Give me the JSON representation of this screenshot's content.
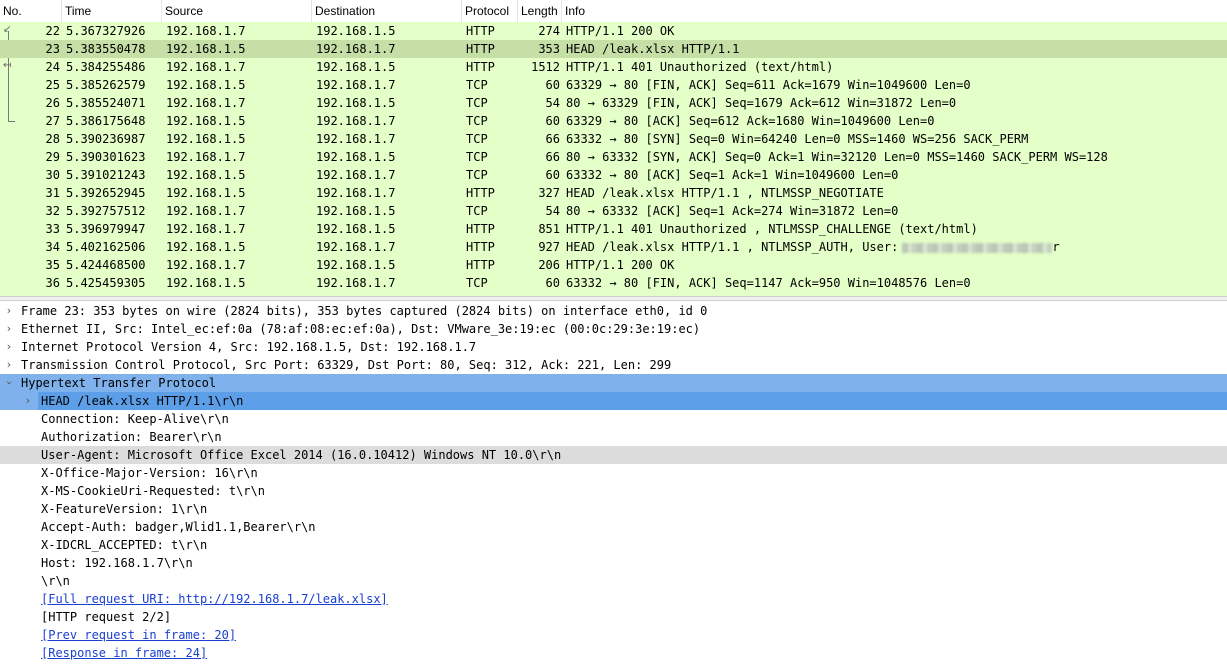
{
  "columns": {
    "no": "No.",
    "time": "Time",
    "source": "Source",
    "destination": "Destination",
    "protocol": "Protocol",
    "length": "Length",
    "info": "Info"
  },
  "packets": [
    {
      "no": "22",
      "time": "5.367327926",
      "src": "192.168.1.7",
      "dst": "192.168.1.5",
      "proto": "HTTP",
      "len": "274",
      "info": "HTTP/1.1 200 OK"
    },
    {
      "no": "23",
      "time": "5.383550478",
      "src": "192.168.1.5",
      "dst": "192.168.1.7",
      "proto": "HTTP",
      "len": "353",
      "info": "HEAD /leak.xlsx HTTP/1.1"
    },
    {
      "no": "24",
      "time": "5.384255486",
      "src": "192.168.1.7",
      "dst": "192.168.1.5",
      "proto": "HTTP",
      "len": "1512",
      "info": "HTTP/1.1 401 Unauthorized  (text/html)"
    },
    {
      "no": "25",
      "time": "5.385262579",
      "src": "192.168.1.5",
      "dst": "192.168.1.7",
      "proto": "TCP",
      "len": "60",
      "info": "63329 → 80 [FIN, ACK] Seq=611 Ack=1679 Win=1049600 Len=0"
    },
    {
      "no": "26",
      "time": "5.385524071",
      "src": "192.168.1.7",
      "dst": "192.168.1.5",
      "proto": "TCP",
      "len": "54",
      "info": "80 → 63329 [FIN, ACK] Seq=1679 Ack=612 Win=31872 Len=0"
    },
    {
      "no": "27",
      "time": "5.386175648",
      "src": "192.168.1.5",
      "dst": "192.168.1.7",
      "proto": "TCP",
      "len": "60",
      "info": "63329 → 80 [ACK] Seq=612 Ack=1680 Win=1049600 Len=0"
    },
    {
      "no": "28",
      "time": "5.390236987",
      "src": "192.168.1.5",
      "dst": "192.168.1.7",
      "proto": "TCP",
      "len": "66",
      "info": "63332 → 80 [SYN] Seq=0 Win=64240 Len=0 MSS=1460 WS=256 SACK_PERM"
    },
    {
      "no": "29",
      "time": "5.390301623",
      "src": "192.168.1.7",
      "dst": "192.168.1.5",
      "proto": "TCP",
      "len": "66",
      "info": "80 → 63332 [SYN, ACK] Seq=0 Ack=1 Win=32120 Len=0 MSS=1460 SACK_PERM WS=128"
    },
    {
      "no": "30",
      "time": "5.391021243",
      "src": "192.168.1.5",
      "dst": "192.168.1.7",
      "proto": "TCP",
      "len": "60",
      "info": "63332 → 80 [ACK] Seq=1 Ack=1 Win=1049600 Len=0"
    },
    {
      "no": "31",
      "time": "5.392652945",
      "src": "192.168.1.5",
      "dst": "192.168.1.7",
      "proto": "HTTP",
      "len": "327",
      "info": "HEAD /leak.xlsx HTTP/1.1 , NTLMSSP_NEGOTIATE"
    },
    {
      "no": "32",
      "time": "5.392757512",
      "src": "192.168.1.7",
      "dst": "192.168.1.5",
      "proto": "TCP",
      "len": "54",
      "info": "80 → 63332 [ACK] Seq=1 Ack=274 Win=31872 Len=0"
    },
    {
      "no": "33",
      "time": "5.396979947",
      "src": "192.168.1.7",
      "dst": "192.168.1.5",
      "proto": "HTTP",
      "len": "851",
      "info": "HTTP/1.1 401 Unauthorized , NTLMSSP_CHALLENGE (text/html)"
    },
    {
      "no": "34",
      "time": "5.402162506",
      "src": "192.168.1.5",
      "dst": "192.168.1.7",
      "proto": "HTTP",
      "len": "927",
      "info": "HEAD /leak.xlsx HTTP/1.1 , NTLMSSP_AUTH, User:",
      "info_tail": "r"
    },
    {
      "no": "35",
      "time": "5.424468500",
      "src": "192.168.1.7",
      "dst": "192.168.1.5",
      "proto": "HTTP",
      "len": "206",
      "info": "HTTP/1.1 200 OK"
    },
    {
      "no": "36",
      "time": "5.425459305",
      "src": "192.168.1.5",
      "dst": "192.168.1.7",
      "proto": "TCP",
      "len": "60",
      "info": "63332 → 80 [FIN, ACK] Seq=1147 Ack=950 Win=1048576 Len=0"
    }
  ],
  "details": {
    "frame": "Frame 23: 353 bytes on wire (2824 bits), 353 bytes captured (2824 bits) on interface eth0, id 0",
    "ethernet": "Ethernet II, Src: Intel_ec:ef:0a (78:af:08:ec:ef:0a), Dst: VMware_3e:19:ec (00:0c:29:3e:19:ec)",
    "ip": "Internet Protocol Version 4, Src: 192.168.1.5, Dst: 192.168.1.7",
    "tcp": "Transmission Control Protocol, Src Port: 63329, Dst Port: 80, Seq: 312, Ack: 221, Len: 299",
    "http": "Hypertext Transfer Protocol",
    "request_line": "HEAD /leak.xlsx HTTP/1.1\\r\\n",
    "headers": [
      "Connection: Keep-Alive\\r\\n",
      "Authorization: Bearer\\r\\n",
      "User-Agent: Microsoft Office Excel 2014 (16.0.10412) Windows NT 10.0\\r\\n",
      "X-Office-Major-Version: 16\\r\\n",
      "X-MS-CookieUri-Requested: t\\r\\n",
      "X-FeatureVersion: 1\\r\\n",
      "Accept-Auth: badger,Wlid1.1,Bearer\\r\\n",
      "X-IDCRL_ACCEPTED: t\\r\\n",
      "Host: 192.168.1.7\\r\\n",
      "\\r\\n"
    ],
    "full_uri": "[Full request URI: http://192.168.1.7/leak.xlsx]",
    "http_request": "[HTTP request 2/2]",
    "prev_request": "[Prev request in frame: 20]",
    "response_in": "[Response in frame: 24]"
  },
  "colors": {
    "packet_bg": "#e4ffc7",
    "selected_bg": "#c6dfa6",
    "tree_highlight": "#7fb2ec",
    "link": "#1a3fd1"
  }
}
